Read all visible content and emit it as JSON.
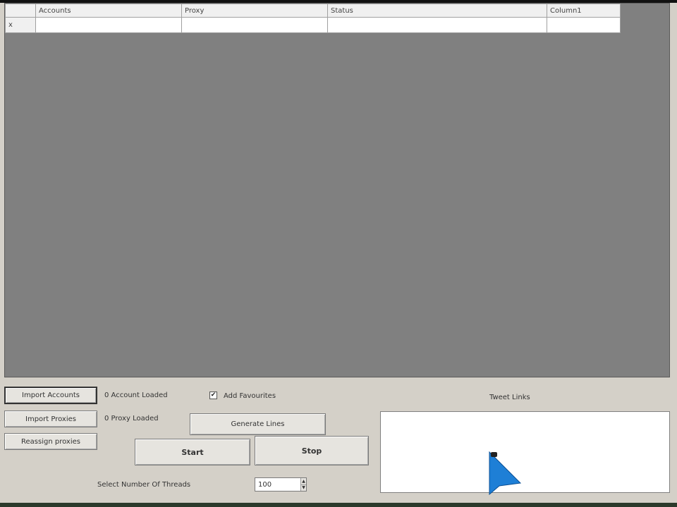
{
  "grid": {
    "columns": [
      "",
      "Accounts",
      "Proxy",
      "Status",
      "Column1"
    ],
    "new_row_marker": "x"
  },
  "buttons": {
    "import_accounts": "Import Accounts",
    "import_proxies": "Import Proxies",
    "reassign_proxies": "Reassign proxies",
    "generate_lines": "Generate Lines",
    "start": "Start",
    "stop": "Stop"
  },
  "status": {
    "accounts_loaded": "0 Account Loaded",
    "proxy_loaded": "0 Proxy Loaded"
  },
  "add_favourites": {
    "label": "Add Favourites",
    "checked": true,
    "check_glyph": "✔"
  },
  "tweet_links": {
    "label": "Tweet Links"
  },
  "threads": {
    "label": "Select Number Of Threads",
    "value": "100"
  },
  "colors": {
    "grid_background": "#808080",
    "window_background": "#d4d0c8",
    "cursor": "#1e7fd6"
  }
}
